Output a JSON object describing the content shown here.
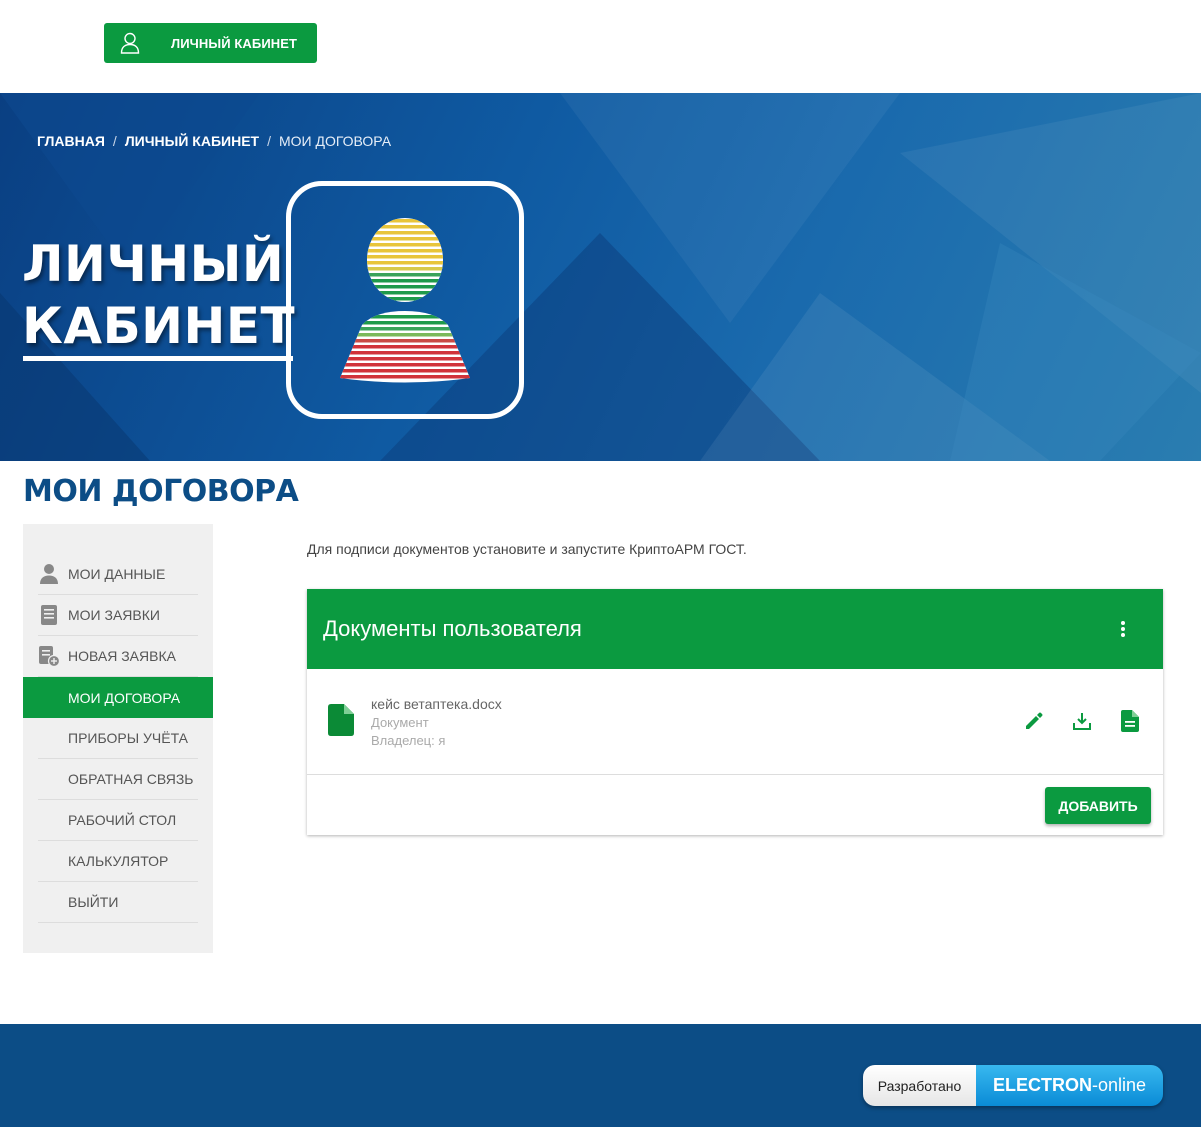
{
  "header": {
    "cabinet_button": "ЛИЧНЫЙ КАБИНЕТ"
  },
  "breadcrumb": {
    "home": "ГЛАВНАЯ",
    "separator": "/",
    "cabinet": "ЛИЧНЫЙ КАБИНЕТ",
    "current": "МОИ ДОГОВОРА"
  },
  "hero": {
    "title_line1": "ЛИЧНЫЙ",
    "title_line2": "КАБИНЕТ"
  },
  "page_title": "МОИ ДОГОВОРА",
  "sidebar": {
    "items": [
      {
        "label": "МОИ ДАННЫЕ",
        "icon": "user-icon"
      },
      {
        "label": "МОИ ЗАЯВКИ",
        "icon": "documents-icon"
      },
      {
        "label": "НОВАЯ ЗАЯВКА",
        "icon": "new-document-icon"
      },
      {
        "label": "МОИ ДОГОВОРА",
        "active": true
      },
      {
        "label": "ПРИБОРЫ УЧЁТА"
      },
      {
        "label": "ОБРАТНАЯ СВЯЗЬ"
      },
      {
        "label": "РАБОЧИЙ СТОЛ"
      },
      {
        "label": "КАЛЬКУЛЯТОР"
      },
      {
        "label": "ВЫЙТИ"
      }
    ]
  },
  "content": {
    "notice": "Для подписи документов установите и запустите КриптоАРМ ГОСТ.",
    "card_title": "Документы пользователя",
    "document": {
      "name": "кейс ветаптека.docx",
      "type": "Документ",
      "owner": "Владелец: я"
    },
    "add_button": "ДОБАВИТЬ"
  },
  "footer": {
    "badge_left": "Разработано",
    "badge_brand": "ELECTRON",
    "badge_suffix": "-online"
  },
  "colors": {
    "green": "#0b9a40",
    "blue_dark": "#0c4d86"
  }
}
